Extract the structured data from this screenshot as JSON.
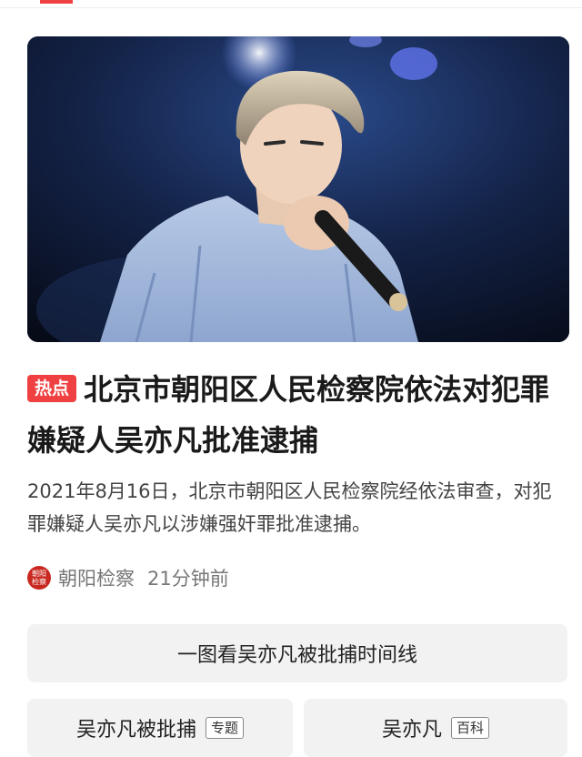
{
  "badge": "热点",
  "headline": "北京市朝阳区人民检察院依法对犯罪嫌疑人吴亦凡批准逮捕",
  "summary": "2021年8月16日，北京市朝阳区人民检察院经依法审查，对犯罪嫌疑人吴亦凡以涉嫌强奸罪批准逮捕。",
  "source": {
    "name": "朝阳检察",
    "time": "21分钟前",
    "logo_text": "朝阳检察",
    "logo_color": "#c8281f"
  },
  "timeline_button": "一图看吴亦凡被批捕时间线",
  "tags": [
    {
      "label": "吴亦凡被批捕",
      "type": "专题"
    },
    {
      "label": "吴亦凡",
      "type": "百科"
    }
  ],
  "colors": {
    "accent": "#f04142",
    "card_bg": "#f2f2f2"
  },
  "icons": {
    "hero": "concert-singer-photo",
    "source_logo": "source-logo-icon"
  }
}
